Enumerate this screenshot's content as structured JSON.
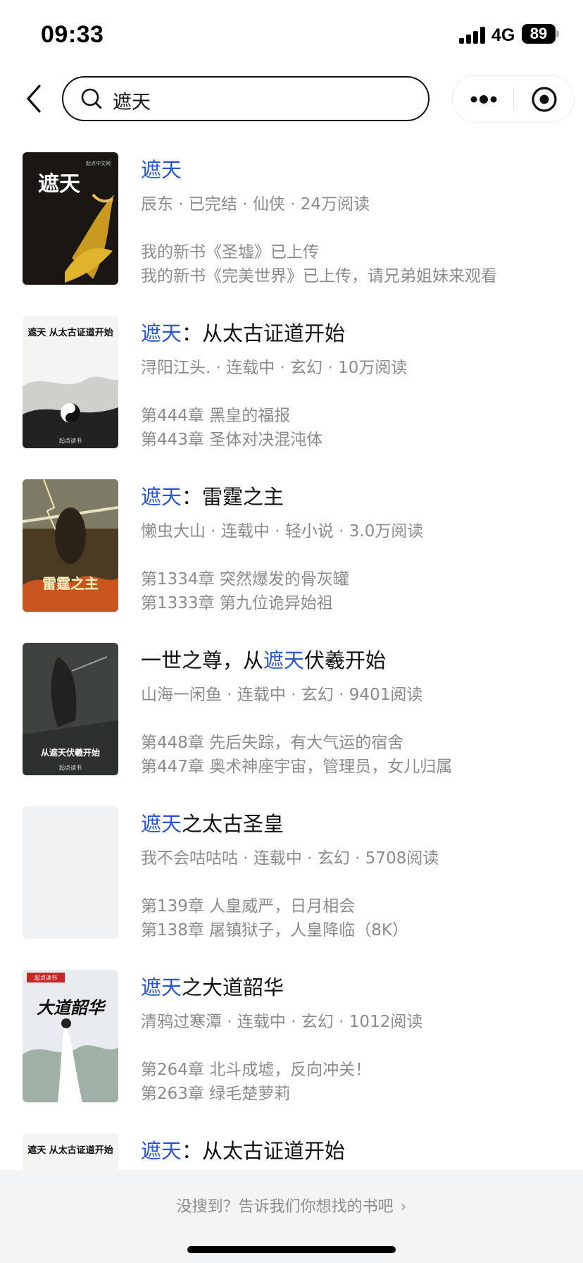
{
  "status_bar": {
    "time": "09:33",
    "network": "4G",
    "battery": "89"
  },
  "search": {
    "query": "遮天"
  },
  "results": [
    {
      "title_pre": "",
      "title_hl": "遮天",
      "title_post": "",
      "meta": "辰东 · 已完结 · 仙侠 · 24万阅读",
      "line1": "我的新书《圣墟》已上传",
      "line2": "我的新书《完美世界》已上传，请兄弟姐妹来观看",
      "cover_text": "遮天"
    },
    {
      "title_pre": "",
      "title_hl": "遮天",
      "title_post": "：从太古证道开始",
      "meta": "浔阳江头. · 连载中 · 玄幻 · 10万阅读",
      "line1": "第444章 黑皇的福报",
      "line2": "第443章 圣体对决混沌体",
      "cover_text": "遮天 从太古证道开始"
    },
    {
      "title_pre": "",
      "title_hl": "遮天",
      "title_post": "：雷霆之主",
      "meta": "懒虫大山 · 连载中 · 轻小说 · 3.0万阅读",
      "line1": "第1334章 突然爆发的骨灰罐",
      "line2": "第1333章 第九位诡异始祖",
      "cover_text": "雷霆之主"
    },
    {
      "title_pre": "一世之尊，从",
      "title_hl": "遮天",
      "title_post": "伏羲开始",
      "meta": "山海一闲鱼 · 连载中 · 玄幻 · 9401阅读",
      "line1": "第448章 先后失踪，有大气运的宿舍",
      "line2": "第447章 奥术神座宇宙，管理员，女儿归属",
      "cover_text": "从遮天伏羲开始"
    },
    {
      "title_pre": "",
      "title_hl": "遮天",
      "title_post": "之太古圣皇",
      "meta": "我不会咕咕咕 · 连载中 · 玄幻 · 5708阅读",
      "line1": "第139章 人皇威严，日月相会",
      "line2": "第138章 屠镇狱子，人皇降临（8K）",
      "cover_text": ""
    },
    {
      "title_pre": "",
      "title_hl": "遮天",
      "title_post": "之大道韶华",
      "meta": "清鸦过寒潭 · 连载中 · 玄幻 · 1012阅读",
      "line1": "第264章 北斗成墟，反向冲关！",
      "line2": "第263章 绿毛楚萝莉",
      "cover_text": "大道韶华"
    },
    {
      "title_pre": "",
      "title_hl": "遮天",
      "title_post": "：从太古证道开始",
      "meta": "",
      "line1": "",
      "line2": "",
      "cover_text": "遮天 从太古证道开始"
    }
  ],
  "footer": {
    "text": "没搜到？告诉我们你想找的书吧",
    "arrow": "›"
  },
  "colors": {
    "highlight": "#2a56d6",
    "meta": "#8b8b8b",
    "footer_bg": "#f3f4f6"
  }
}
